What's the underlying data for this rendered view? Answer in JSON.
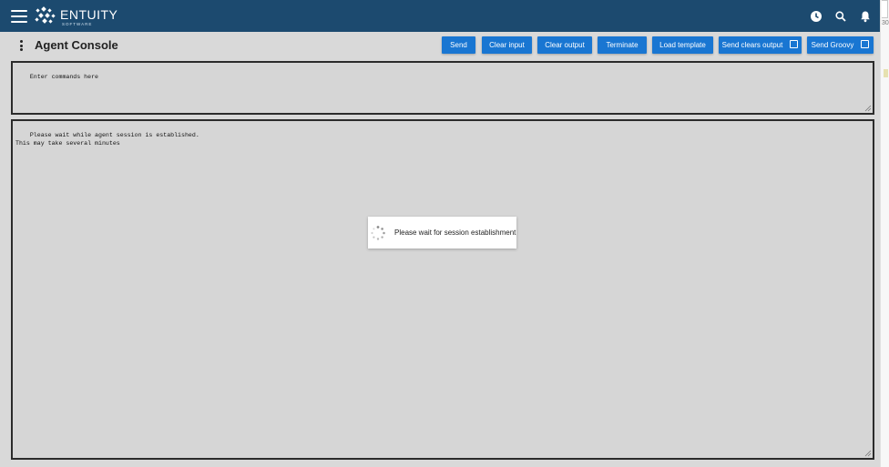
{
  "app": {
    "brand": "ENTUITY",
    "brand_sub": "SOFTWARE",
    "side_edge_text": "30"
  },
  "topbar_icons": [
    "time-icon",
    "search-icon",
    "bell-icon"
  ],
  "console": {
    "title": "Agent Console",
    "buttons": {
      "send": "Send",
      "clear_input": "Clear input",
      "clear_output": "Clear output",
      "terminate": "Terminate",
      "load_template": "Load template",
      "send_clears_output": "Send clears output",
      "send_groovy": "Send Groovy"
    },
    "input_placeholder": "Enter commands here",
    "output_text": "Please wait while agent session is established.\nThis may take several minutes",
    "loading_message": "Please wait for session establishment"
  },
  "colors": {
    "topbar": "#1c4a6f",
    "button": "#1976d2",
    "panel_bg": "#d9d9d9"
  }
}
